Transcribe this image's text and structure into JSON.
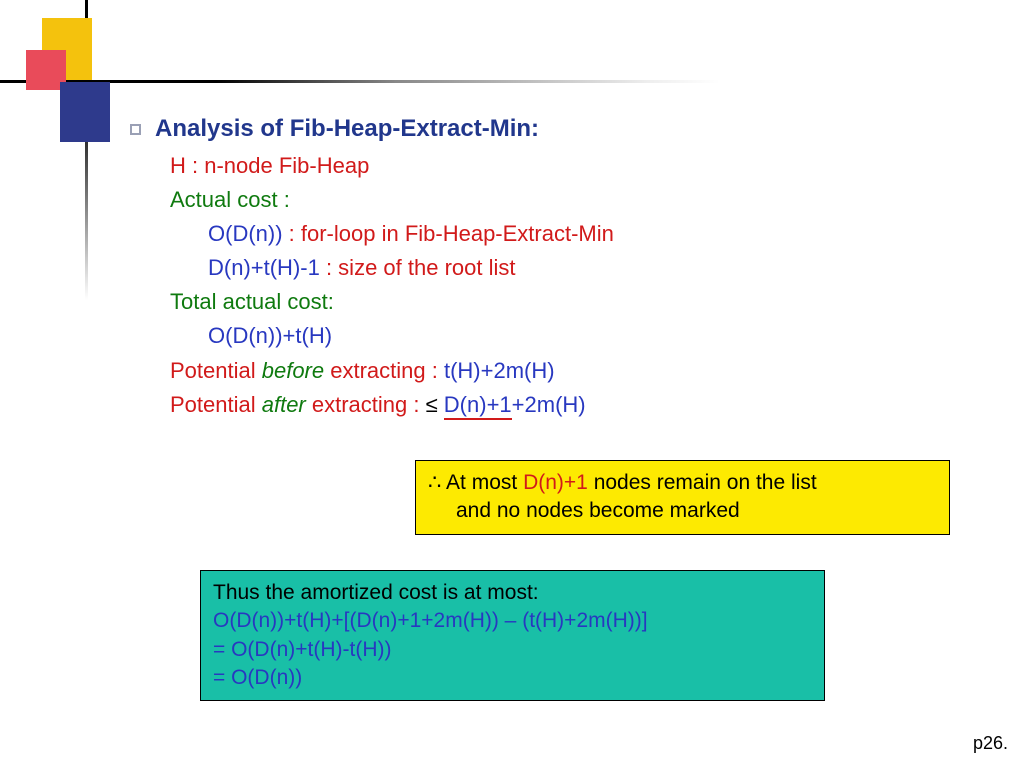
{
  "title": "Analysis of Fib-Heap-Extract-Min:",
  "lines": {
    "h_def": "H : n-node Fib-Heap",
    "actual_label": "Actual cost :",
    "actual1_a": "O(D(n))",
    "actual1_b": " : for-loop in Fib-Heap-Extract-Min",
    "actual2_a": "D(n)+t(H)-1",
    "actual2_b": " : size of the root list",
    "total_label": "Total actual cost:",
    "total_val": "O(D(n))+t(H)",
    "pot_before_a": "Potential ",
    "pot_before_b": "before",
    "pot_before_c": " extracting : ",
    "pot_before_val": "t(H)+2m(H)",
    "pot_after_a": "Potential ",
    "pot_after_b": "after",
    "pot_after_c": " extracting : ",
    "pot_after_leq": "≤ ",
    "pot_after_under": "D(n)+1",
    "pot_after_tail": "+2m(H)"
  },
  "yellow_box": {
    "therefore": "∴",
    "a": " At most ",
    "dn1": "D(n)+1",
    "b": " nodes remain on the list",
    "c": "and no nodes become marked"
  },
  "teal_box": {
    "l1": "Thus the amortized cost is at most:",
    "l2": "O(D(n))+t(H)+[(D(n)+1+2m(H)) – (t(H)+2m(H))]",
    "l3": "= O(D(n)+t(H)-t(H))",
    "l4": "= O(D(n))"
  },
  "credit": "p26."
}
